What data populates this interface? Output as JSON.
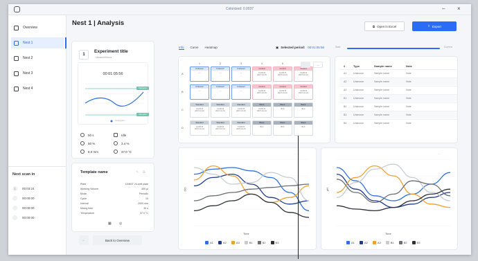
{
  "window": {
    "title": "Colonized: 0.0037"
  },
  "sidebar": {
    "items": [
      {
        "label": "Overview",
        "active": false
      },
      {
        "label": "Nest 1",
        "active": true
      },
      {
        "label": "Nest 2",
        "active": false
      },
      {
        "label": "Nest 3",
        "active": false
      },
      {
        "label": "Nest 4",
        "active": false
      }
    ],
    "next_scan": {
      "title": "Next scan in",
      "rows": [
        {
          "num": "1",
          "time": "00:03:24"
        },
        {
          "num": "",
          "time": "00:00:00"
        },
        {
          "num": "",
          "time": "00:00:00"
        },
        {
          "num": "",
          "time": "00:00:00"
        }
      ]
    }
  },
  "header": {
    "title": "Nest 1 | Analysis",
    "open_excel": "Open in Excel",
    "export": "Export"
  },
  "experiment": {
    "number": "1",
    "title": "Experiment title",
    "subtitle": "Ukraine/Kiruna",
    "timer": "00:01:05:56",
    "stats": [
      {
        "icon": "rpm-icon",
        "value": "50 s"
      },
      {
        "icon": "idle-icon",
        "value": "Idle"
      },
      {
        "icon": "percent-icon",
        "value": "50 %"
      },
      {
        "icon": "co2-icon",
        "value": "3.4 %"
      },
      {
        "icon": "volume-icon",
        "value": "8.0 mm"
      },
      {
        "icon": "temperature-icon",
        "value": "37.0 °C"
      }
    ],
    "badges": [
      "Start point",
      "Now point"
    ],
    "legend_dot": "Current time"
  },
  "template": {
    "title": "Template name",
    "rows": [
      {
        "label": "Plate",
        "value": "CANST 24-well plate"
      },
      {
        "label": "Working Volume",
        "value": "400 µl"
      },
      {
        "label": "Mode",
        "value": "Periodic"
      },
      {
        "label": "Cycle",
        "value": "10"
      },
      {
        "label": "Interval",
        "value": "2000 min"
      },
      {
        "label": "Mixing time",
        "value": "30 s"
      },
      {
        "label": "Temperature",
        "value": "37.0 °C"
      }
    ],
    "back": "Back to Overview"
  },
  "analysis": {
    "tabs": [
      {
        "label": "Info",
        "active": true
      },
      {
        "label": "Curve",
        "active": false
      },
      {
        "label": "Heatmap",
        "active": false
      }
    ],
    "selected_label": "Selected period:",
    "selected_value": "00:01:05:56",
    "slider_start": "Start",
    "slider_end": "Current"
  },
  "plate": {
    "columns": [
      "1",
      "2",
      "3",
      "4",
      "5",
      "6"
    ],
    "rows": [
      "A",
      "B",
      "C",
      "D"
    ],
    "buttons": [
      "",
      "—"
    ],
    "cells": [
      [
        {
          "t": "unk",
          "h": "Unknown",
          "s": "—"
        },
        {
          "t": "unk",
          "h": "Unknown",
          "s": "—"
        },
        {
          "t": "unk",
          "h": "Unknown",
          "s": "—"
        },
        {
          "t": "ctl",
          "h": "Control",
          "s": "CANS B\n2007-10-01"
        },
        {
          "t": "ctl",
          "h": "Control",
          "s": "CANS B\n2007-10-01"
        },
        {
          "t": "ctl",
          "h": "Control",
          "s": "CANS B\n2007-10-01"
        }
      ],
      [
        {
          "t": "unk",
          "h": "Unknown",
          "s": "—"
        },
        {
          "t": "unk",
          "h": "Unknown",
          "s": "—"
        },
        {
          "t": "unk",
          "h": "Unknown",
          "s": "—"
        },
        {
          "t": "ctl",
          "h": "Control",
          "s": "CANS B\n2007-10-01"
        },
        {
          "t": "ctl",
          "h": "Control",
          "s": "CANS B\n2007-10-01"
        },
        {
          "t": "ctl",
          "h": "Control",
          "s": "CANS B\n2007-10-01"
        }
      ],
      [
        {
          "t": "std",
          "h": "Standard",
          "s": "CANS B\n2007-10-01"
        },
        {
          "t": "std",
          "h": "Standard",
          "s": "CANS B\n2007-10-01"
        },
        {
          "t": "std",
          "h": "Standard",
          "s": "CANS B\n2007-10-01"
        },
        {
          "t": "blk",
          "h": "Blank",
          "s": "CANS B\n2007-10-01"
        },
        {
          "t": "blk",
          "h": "Blank",
          "s": "BLK"
        },
        {
          "t": "blk",
          "h": "Blank",
          "s": "BLK"
        }
      ],
      [
        {
          "t": "std",
          "h": "Standard",
          "s": "CANS B\n2007-10-01"
        },
        {
          "t": "std",
          "h": "Standard",
          "s": "CANS B\n2007-10-01"
        },
        {
          "t": "std",
          "h": "Standard",
          "s": "CANS B\n2007-10-01"
        },
        {
          "t": "blk",
          "h": "Blank",
          "s": "BLK"
        },
        {
          "t": "blk",
          "h": "Blank",
          "s": "BLK"
        },
        {
          "t": "blk",
          "h": "Blank",
          "s": "BLK"
        }
      ]
    ]
  },
  "sample_table": {
    "headers": [
      "#",
      "Type",
      "Sample name",
      "Note"
    ],
    "rows": [
      [
        "A1",
        "Unknown",
        "Sample name",
        "Note"
      ],
      [
        "A2",
        "Unknown",
        "Sample name",
        "Note"
      ],
      [
        "A3",
        "Unknown",
        "Sample name",
        "Note"
      ],
      [
        "B1",
        "Unknown",
        "Sample name",
        "Note"
      ],
      [
        "B2",
        "Unknown",
        "Sample name",
        "Note"
      ],
      [
        "B3",
        "Unknown",
        "Sample name",
        "Note"
      ],
      [
        "B4",
        "Unknown",
        "Sample name",
        "Note"
      ]
    ]
  },
  "chart_data": [
    {
      "type": "line",
      "title": "",
      "xlabel": "Time",
      "ylabel": "DO",
      "x": [
        0,
        1,
        2,
        3,
        4,
        5,
        6
      ],
      "series": [
        {
          "name": "A1",
          "color": "#2f6fe0",
          "values": [
            62,
            68,
            70,
            66,
            58,
            40,
            18
          ]
        },
        {
          "name": "A2",
          "color": "#1e3a8a",
          "values": [
            48,
            58,
            62,
            50,
            34,
            26,
            30
          ]
        },
        {
          "name": "A3",
          "color": "#f0a030",
          "values": [
            55,
            72,
            60,
            38,
            28,
            34,
            48
          ]
        },
        {
          "name": "B1",
          "color": "#c8ccd2",
          "values": [
            70,
            62,
            50,
            52,
            64,
            58,
            30
          ]
        },
        {
          "name": "B2",
          "color": "#6a6e75",
          "values": [
            30,
            36,
            40,
            44,
            46,
            48,
            50
          ]
        },
        {
          "name": "B3",
          "color": "#2b2f36",
          "values": [
            18,
            24,
            30,
            38,
            28,
            16,
            10
          ]
        }
      ]
    },
    {
      "type": "line",
      "title": "",
      "xlabel": "Time",
      "ylabel": "pH",
      "x": [
        0,
        1,
        2,
        3,
        4,
        5,
        6
      ],
      "series": [
        {
          "name": "A1",
          "color": "#2f6fe0",
          "values": [
            70,
            54,
            36,
            30,
            38,
            50,
            64
          ]
        },
        {
          "name": "A2",
          "color": "#1e3a8a",
          "values": [
            62,
            44,
            30,
            22,
            26,
            34,
            40
          ]
        },
        {
          "name": "A3",
          "color": "#f0a030",
          "values": [
            40,
            58,
            72,
            60,
            38,
            26,
            22
          ]
        },
        {
          "name": "B1",
          "color": "#c8ccd2",
          "values": [
            34,
            52,
            68,
            74,
            58,
            40,
            30
          ]
        },
        {
          "name": "B2",
          "color": "#6a6e75",
          "values": [
            56,
            40,
            28,
            38,
            54,
            50,
            36
          ]
        },
        {
          "name": "B3",
          "color": "#2b2f36",
          "values": [
            24,
            20,
            18,
            22,
            30,
            38,
            44
          ]
        }
      ]
    }
  ]
}
